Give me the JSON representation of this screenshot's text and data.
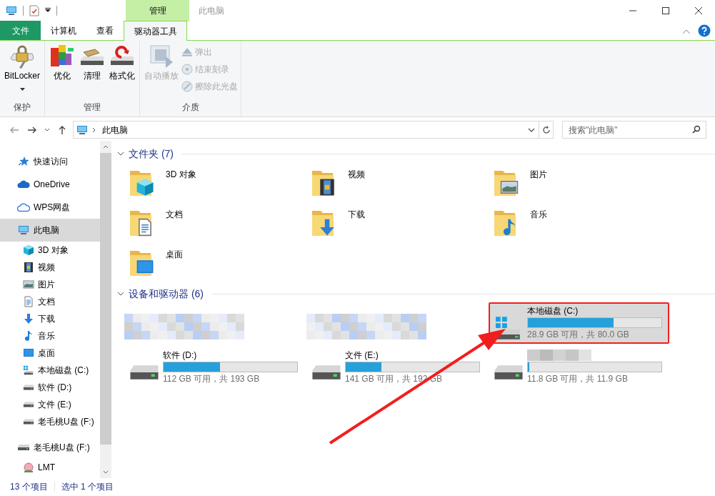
{
  "title_bar": {
    "context_tab": "管理",
    "title": "此电脑"
  },
  "ribbon_tabs": [
    {
      "label": "文件",
      "kind": "file",
      "selected": false
    },
    {
      "label": "计算机",
      "kind": "tab",
      "selected": false
    },
    {
      "label": "查看",
      "kind": "tab",
      "selected": false
    },
    {
      "label": "驱动器工具",
      "kind": "tab",
      "selected": true
    }
  ],
  "ribbon_groups": [
    {
      "label": "保护",
      "commands": [
        {
          "label": "BitLocker",
          "kind": "large",
          "dropdown": true,
          "disabled": false
        }
      ]
    },
    {
      "label": "管理",
      "commands": [
        {
          "label": "优化",
          "kind": "large",
          "disabled": false
        },
        {
          "label": "清理",
          "kind": "large",
          "disabled": false
        },
        {
          "label": "格式化",
          "kind": "large",
          "disabled": false
        }
      ]
    },
    {
      "label": "介质",
      "commands": [
        {
          "label": "自动播放",
          "kind": "large",
          "disabled": true
        },
        {
          "label": "弹出",
          "kind": "small",
          "disabled": true
        },
        {
          "label": "结束刻录",
          "kind": "small",
          "disabled": true
        },
        {
          "label": "擦除此光盘",
          "kind": "small",
          "disabled": true
        }
      ]
    }
  ],
  "address_bar": {
    "path": "此电脑",
    "search": {
      "placeholder": "搜索\"此电脑\""
    }
  },
  "sidebar": {
    "items": [
      {
        "label": "快速访问",
        "kind": "star",
        "selected": false
      },
      {
        "label": "OneDrive",
        "kind": "cloud",
        "selected": false
      },
      {
        "label": "WPS网盘",
        "kind": "cloudline",
        "selected": false
      },
      {
        "label": "此电脑",
        "kind": "pc",
        "selected": true,
        "children": [
          {
            "label": "3D 对象",
            "kind": "cube",
            "selected": false
          },
          {
            "label": "视频",
            "kind": "film",
            "selected": false
          },
          {
            "label": "图片",
            "kind": "image",
            "selected": false
          },
          {
            "label": "文档",
            "kind": "doc",
            "selected": false
          },
          {
            "label": "下载",
            "kind": "down",
            "selected": false
          },
          {
            "label": "音乐",
            "kind": "note",
            "selected": false
          },
          {
            "label": "桌面",
            "kind": "desktop",
            "selected": false
          },
          {
            "label": "本地磁盘 (C:)",
            "kind": "windrive",
            "selected": false
          },
          {
            "label": "软件 (D:)",
            "kind": "drive",
            "selected": false
          },
          {
            "label": "文件 (E:)",
            "kind": "drive",
            "selected": false
          },
          {
            "label": "老毛桃U盘 (F:)",
            "kind": "drive",
            "selected": false
          }
        ]
      },
      {
        "label": "老毛桃U盘 (F:)",
        "kind": "drive",
        "selected": false,
        "children": [
          {
            "label": "LMT",
            "kind": "peach",
            "selected": false
          }
        ]
      }
    ]
  },
  "sections": [
    {
      "title": "文件夹 (7)",
      "kind": "folders",
      "items": [
        {
          "label": "3D 对象",
          "kind": "cube"
        },
        {
          "label": "视频",
          "kind": "film"
        },
        {
          "label": "图片",
          "kind": "image"
        },
        {
          "label": "文档",
          "kind": "doc"
        },
        {
          "label": "下载",
          "kind": "down"
        },
        {
          "label": "音乐",
          "kind": "note"
        },
        {
          "label": "桌面",
          "kind": "desktop"
        }
      ]
    },
    {
      "title": "设备和驱动器 (6)",
      "kind": "drives",
      "items": [
        {
          "kind": "redacted"
        },
        {
          "kind": "redacted"
        },
        {
          "kind": "system_drive",
          "name": "本地磁盘 (C:)",
          "level": 0.64,
          "reading": "28.9 GB 可用，共 80.0 GB",
          "selected": true,
          "annotated": true
        },
        {
          "kind": "drive",
          "name": "软件 (D:)",
          "level": 0.42,
          "reading": "112 GB 可用，共 193 GB",
          "selected": false,
          "annotated": false
        },
        {
          "kind": "drive",
          "name": "文件 (E:)",
          "level": 0.27,
          "reading": "141 GB 可用，共 192 GB",
          "selected": false,
          "annotated": false
        },
        {
          "kind": "drive",
          "level": 0.01,
          "reading": "11.8 GB 可用，共 11.9 GB",
          "selected": false,
          "annotated": false
        }
      ]
    }
  ],
  "status_bar": [
    "13 个项目",
    "选中 1 个项目"
  ]
}
